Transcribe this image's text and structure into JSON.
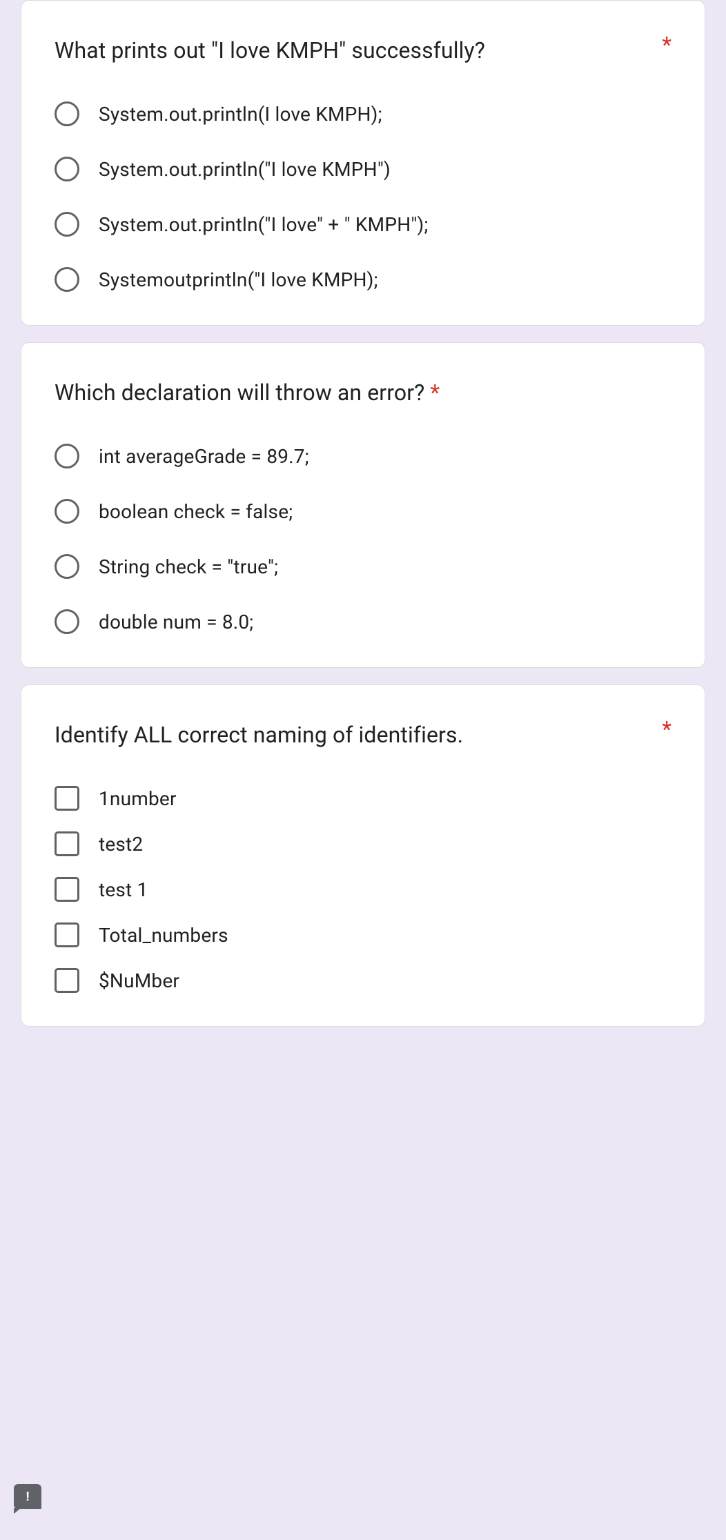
{
  "questions": [
    {
      "text": "What prints out \"I love KMPH\" successfully?",
      "required": true,
      "type": "radio",
      "options": [
        "System.out.println(I love KMPH);",
        "System.out.println(\"I love KMPH\")",
        "System.out.println(\"I love\" + \" KMPH\");",
        "Systemoutprintln(\"I love KMPH);"
      ]
    },
    {
      "text": "Which declaration will throw an error?",
      "required": true,
      "required_inline": true,
      "type": "radio",
      "options": [
        "int averageGrade = 89.7;",
        "boolean check = false;",
        "String check = \"true\";",
        "double num = 8.0;"
      ]
    },
    {
      "text": "Identify ALL correct naming of identifiers.",
      "required": true,
      "type": "checkbox",
      "options": [
        "1number",
        "test2",
        "test 1",
        "Total_numbers",
        "$NuMber"
      ]
    }
  ],
  "fab_icon": "!"
}
